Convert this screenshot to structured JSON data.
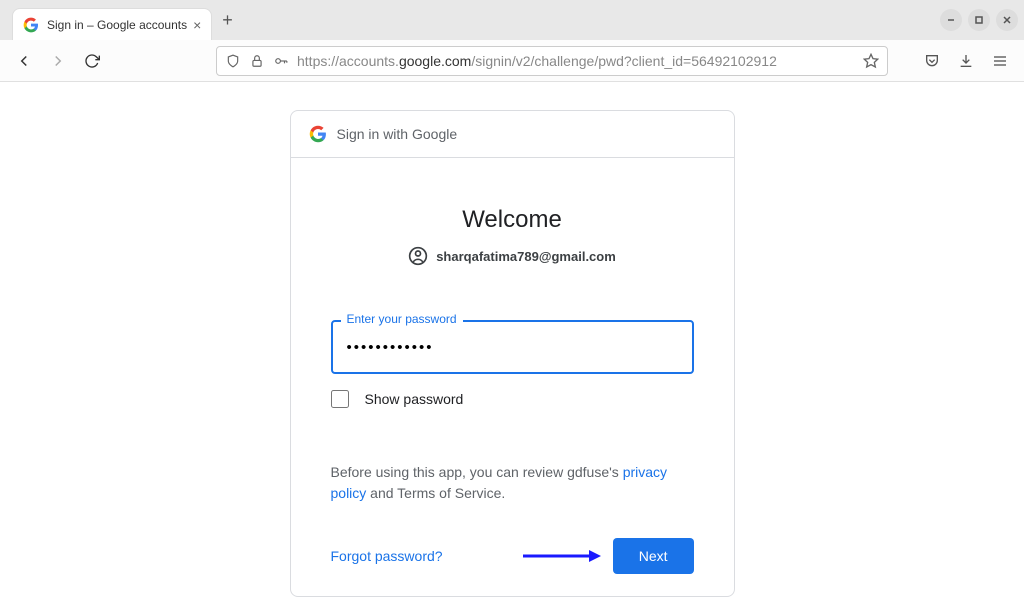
{
  "browser": {
    "tab_title": "Sign in – Google accounts",
    "url_prefix": "https://accounts.",
    "url_domain": "google.com",
    "url_suffix": "/signin/v2/challenge/pwd?client_id=56492102912"
  },
  "card": {
    "header_text": "Sign in with Google",
    "welcome": "Welcome",
    "email": "sharqafatima789@gmail.com",
    "password_label": "Enter your password",
    "password_value": "••••••••••••",
    "show_password_label": "Show password",
    "disclosure_prefix": "Before using this app, you can review gdfuse's ",
    "privacy_link": "privacy policy",
    "disclosure_mid": " and Terms of Service.",
    "forgot": "Forgot password?",
    "next": "Next"
  }
}
